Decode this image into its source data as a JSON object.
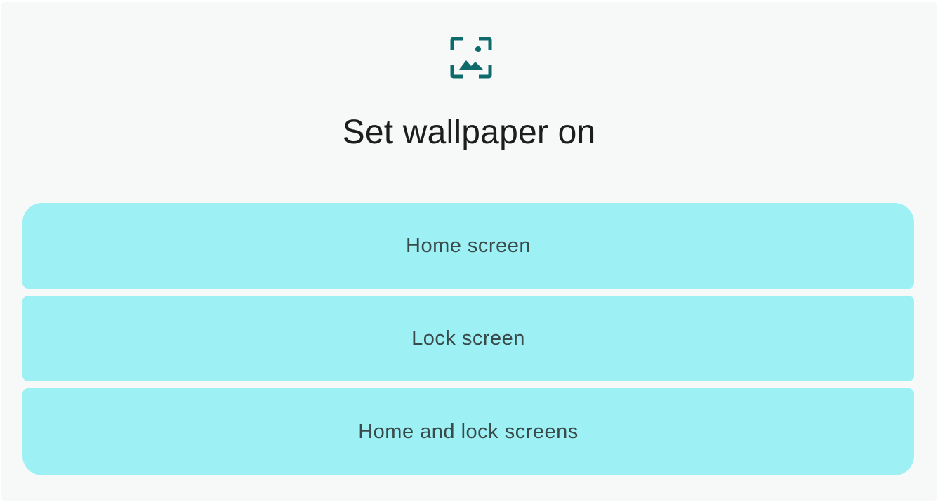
{
  "dialog": {
    "icon": "wallpaper-icon",
    "title": "Set wallpaper on",
    "accent_color": "#0f6b6b",
    "option_color": "#9df0f4",
    "options": [
      {
        "label": "Home screen"
      },
      {
        "label": "Lock screen"
      },
      {
        "label": "Home and lock screens"
      }
    ]
  }
}
